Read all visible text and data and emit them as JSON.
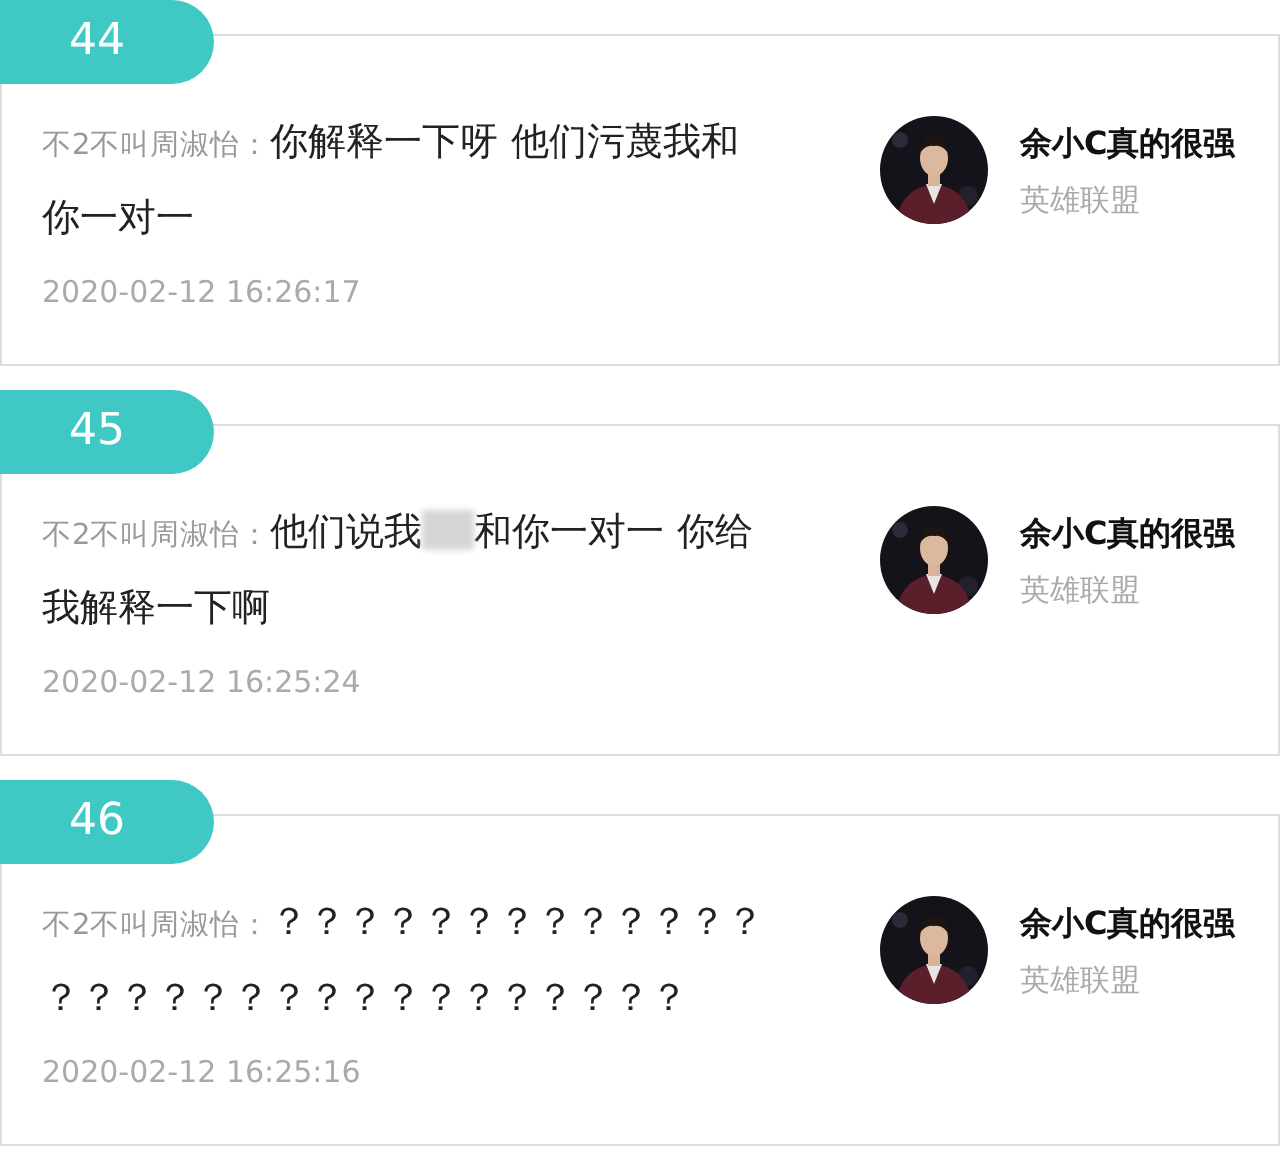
{
  "comments": [
    {
      "number": "44",
      "author": "不2不叫周淑怡：",
      "segments": [
        {
          "kind": "text",
          "text": "你解释一下呀 他们污蔑我和你一对一"
        }
      ],
      "time": "2020-02-12 16:26:17",
      "user": {
        "name": "余小C真的很强",
        "game": "英雄联盟"
      }
    },
    {
      "number": "45",
      "author": "不2不叫周淑怡：",
      "segments": [
        {
          "kind": "text",
          "text": "他们说我"
        },
        {
          "kind": "redacted"
        },
        {
          "kind": "text",
          "text": "和你一对一 你给我解释一下啊"
        }
      ],
      "time": "2020-02-12 16:25:24",
      "user": {
        "name": "余小C真的很强",
        "game": "英雄联盟"
      }
    },
    {
      "number": "46",
      "author": "不2不叫周淑怡：",
      "segments": [
        {
          "kind": "text",
          "text": "？？？？？？？？？？？？？？？？？？？？？？？？？？？？？？"
        }
      ],
      "time": "2020-02-12 16:25:16",
      "user": {
        "name": "余小C真的很强",
        "game": "英雄联盟"
      }
    }
  ]
}
